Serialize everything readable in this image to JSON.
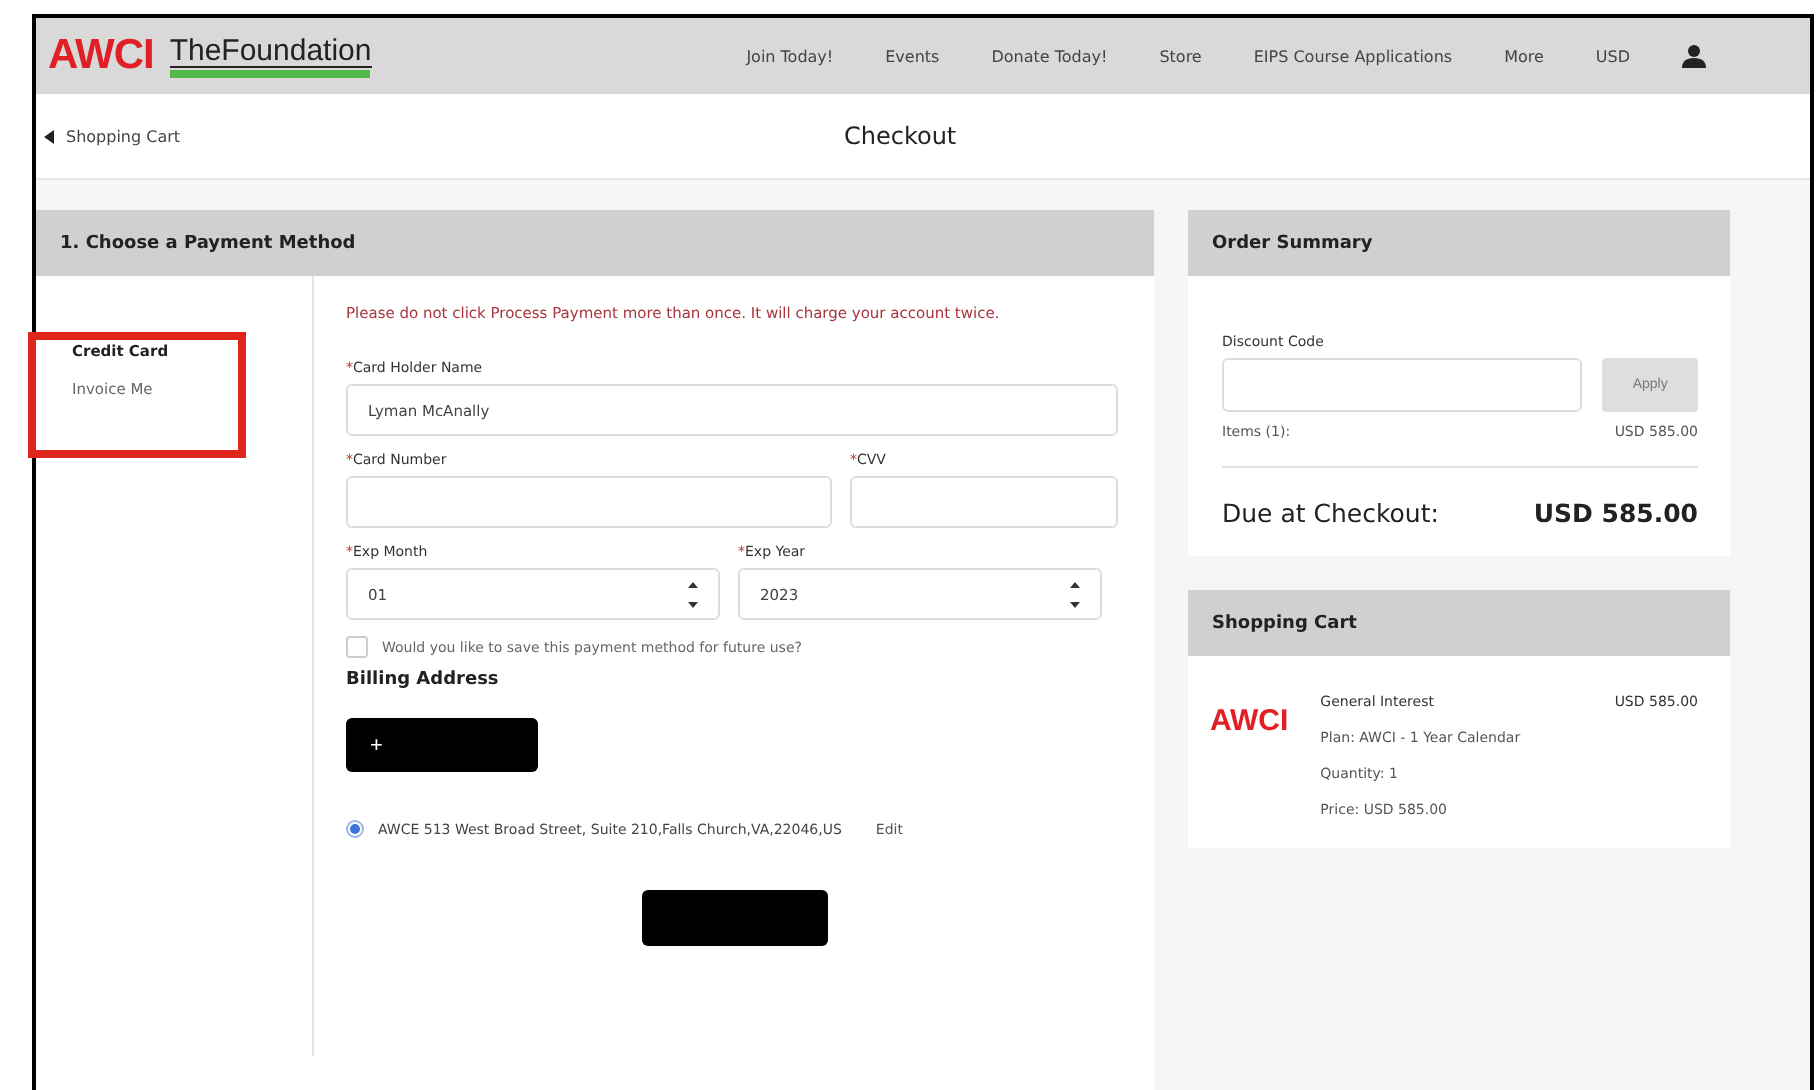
{
  "header": {
    "logo": "AWCI",
    "brand": "TheFoundation",
    "nav": [
      "Join Today!",
      "Events",
      "Donate Today!",
      "Store",
      "EIPS Course Applications",
      "More",
      "USD"
    ]
  },
  "breadcrumb": {
    "back": "Shopping Cart",
    "title": "Checkout"
  },
  "payment": {
    "title": "1. Choose a Payment Method",
    "methods": [
      {
        "label": "Credit Card",
        "selected": true
      },
      {
        "label": "Invoice Me",
        "selected": false
      }
    ],
    "warning": "Please do not click Process Payment more than once. It will charge your account twice.",
    "fields": [
      {
        "mark": "*",
        "label": "Card Holder Name",
        "value": "Lyman McAnally",
        "kind": "text"
      },
      {
        "mark": "*",
        "label": "Card Number",
        "kind": "text"
      },
      {
        "mark": "*",
        "label": "CVV",
        "kind": "text"
      },
      {
        "mark": "*",
        "label": "Exp Month",
        "value": "01",
        "kind": "spinner"
      },
      {
        "mark": "*",
        "label": "Exp Year",
        "value": "2023",
        "kind": "spinner"
      }
    ],
    "save_option": {
      "label": "Would you like to save this payment method for future use?",
      "checked": false
    },
    "billing_title": "Billing Address",
    "add_button": "+",
    "address": {
      "text": "AWCE 513 West Broad Street, Suite 210,Falls Church,VA,22046,US",
      "selected": true,
      "edit": "Edit"
    }
  },
  "summary": {
    "title": "Order Summary",
    "discount_label": "Discount Code",
    "apply": {
      "label": "Apply",
      "disabled": true
    },
    "items_label": "Items (1):",
    "items_value": "USD 585.00",
    "due_label": "Due at Checkout:",
    "due_value": "USD 585.00"
  },
  "cart": {
    "title": "Shopping Cart",
    "logo": "AWCI",
    "name": "General Interest",
    "price": "USD 585.00",
    "plan": "Plan: AWCI - 1 Year Calendar",
    "quantity": "Quantity: 1",
    "unit_price": "Price: USD 585.00"
  }
}
